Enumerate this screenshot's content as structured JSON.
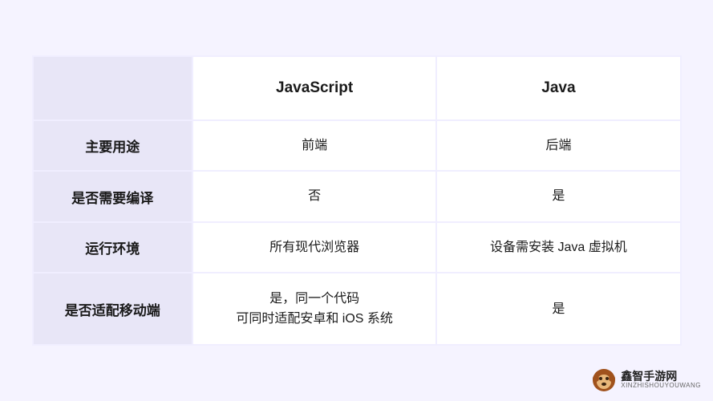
{
  "chart_data": {
    "type": "table",
    "columns": [
      "JavaScript",
      "Java"
    ],
    "rows": [
      {
        "label": "主要用途",
        "values": [
          "前端",
          "后端"
        ]
      },
      {
        "label": "是否需要编译",
        "values": [
          "否",
          "是"
        ]
      },
      {
        "label": "运行环境",
        "values": [
          "所有现代浏览器",
          "设备需安装 Java 虚拟机"
        ]
      },
      {
        "label": "是否适配移动端",
        "values": [
          "是，同一个代码\n可同时适配安卓和 iOS 系统",
          "是"
        ]
      }
    ]
  },
  "watermark": {
    "name_cn": "鑫智手游网",
    "name_en": "XINZHISHOUYOUWANG"
  }
}
